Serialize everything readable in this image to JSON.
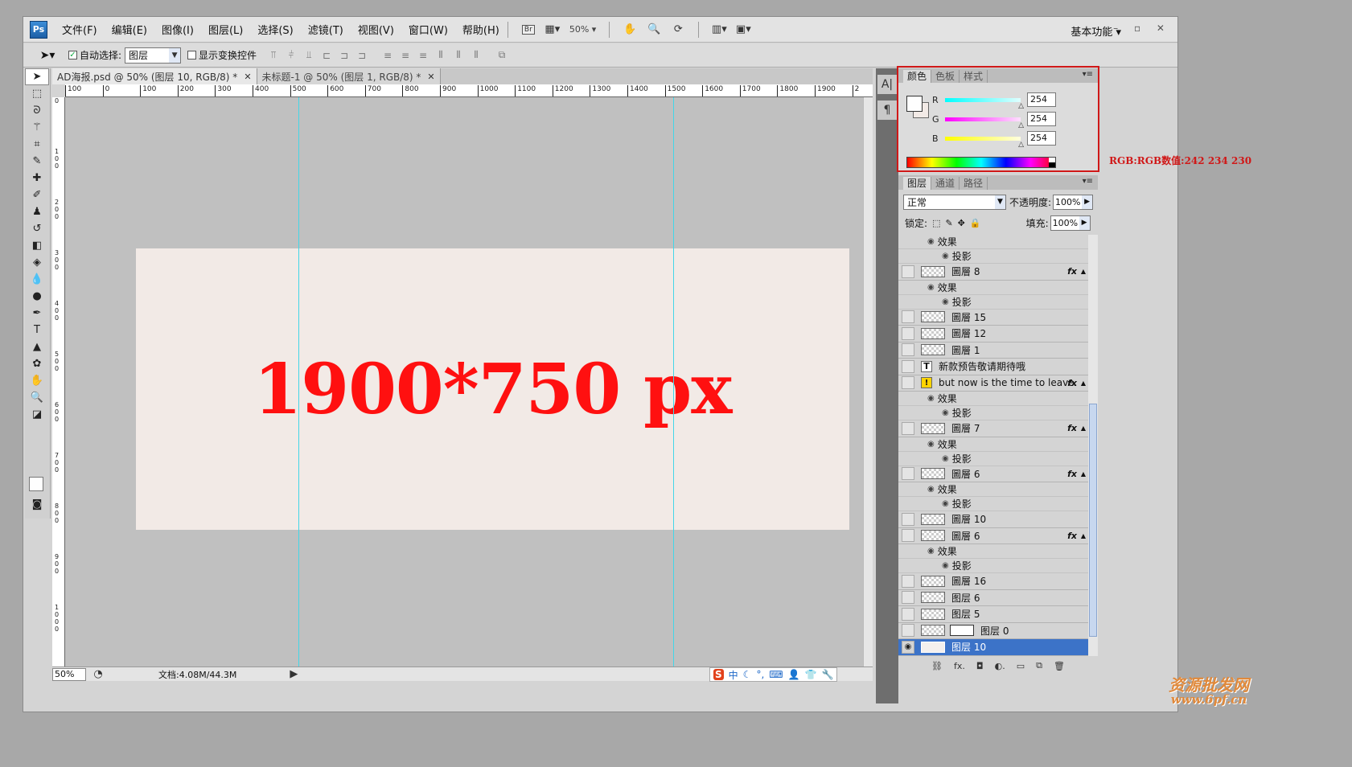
{
  "app": {
    "logo": "Ps",
    "workspace": "基本功能 ▾",
    "window_controls": "– ▫ ✕"
  },
  "menu": [
    "文件(F)",
    "编辑(E)",
    "图像(I)",
    "图层(L)",
    "选择(S)",
    "滤镜(T)",
    "视图(V)",
    "窗口(W)",
    "帮助(H)"
  ],
  "toolbar": {
    "bridge": "Br",
    "zoom": "50%"
  },
  "options": {
    "auto_select_label": "自动选择:",
    "auto_select_checked": true,
    "auto_select_value": "图层",
    "show_transform_label": "显示变换控件",
    "show_transform_checked": false
  },
  "doc_tabs": [
    {
      "label": "AD海报.psd @ 50% (图层 10, RGB/8) *",
      "active": true
    },
    {
      "label": "未标题-1 @ 50% (图层 1, RGB/8) *",
      "active": false
    }
  ],
  "ruler": {
    "h": [
      "100",
      "0",
      "100",
      "200",
      "300",
      "400",
      "500",
      "600",
      "700",
      "800",
      "900",
      "1000",
      "1100",
      "1200",
      "1300",
      "1400",
      "1500",
      "1600",
      "1700",
      "1800",
      "1900",
      "2"
    ],
    "v": [
      "0",
      "1 0 0",
      "2 0 0",
      "3 0 0",
      "4 0 0",
      "5 0 0",
      "6 0 0",
      "7 0 0",
      "8 0 0",
      "9 0 0",
      "1 0 0 0"
    ]
  },
  "canvas": {
    "text": "1900*750 px",
    "bg_color": "#f2eae6",
    "text_color": "#ff1010"
  },
  "status": {
    "zoom": "50%",
    "doc_info": "文档:4.08M/44.3M",
    "ime": "中"
  },
  "color_panel": {
    "tabs": [
      "颜色",
      "色板",
      "样式"
    ],
    "r": "254",
    "g": "254",
    "b": "254"
  },
  "annotation": "RGB:RGB数值:242  234  230",
  "layers_panel": {
    "tabs": [
      "图层",
      "通道",
      "路径"
    ],
    "blend_mode": "正常",
    "opacity_label": "不透明度:",
    "opacity": "100%",
    "lock_label": "锁定:",
    "fill_label": "填充:",
    "fill": "100%",
    "rows": [
      {
        "kind": "effect",
        "label": "效果"
      },
      {
        "kind": "shadow",
        "label": "投影"
      },
      {
        "kind": "layer",
        "label": "圖層 8",
        "fx": true
      },
      {
        "kind": "effect",
        "label": "效果"
      },
      {
        "kind": "shadow",
        "label": "投影"
      },
      {
        "kind": "layer",
        "label": "圖層 15"
      },
      {
        "kind": "layer",
        "label": "圖層 12"
      },
      {
        "kind": "layer",
        "label": "圖層 1"
      },
      {
        "kind": "text",
        "label": "新款预告敬请期待哦"
      },
      {
        "kind": "warn",
        "label": "but now is the time to leave.",
        "fx": true
      },
      {
        "kind": "effect",
        "label": "效果"
      },
      {
        "kind": "shadow",
        "label": "投影"
      },
      {
        "kind": "layer",
        "label": "圖層 7",
        "fx": true
      },
      {
        "kind": "effect",
        "label": "效果"
      },
      {
        "kind": "shadow",
        "label": "投影"
      },
      {
        "kind": "layer",
        "label": "圖層 6",
        "fx": true
      },
      {
        "kind": "effect",
        "label": "效果"
      },
      {
        "kind": "shadow",
        "label": "投影"
      },
      {
        "kind": "layer",
        "label": "圖層 10"
      },
      {
        "kind": "layer",
        "label": "圖層 6",
        "fx": true
      },
      {
        "kind": "effect",
        "label": "效果"
      },
      {
        "kind": "shadow",
        "label": "投影"
      },
      {
        "kind": "layer",
        "label": "圖層 16"
      },
      {
        "kind": "layer",
        "label": "图层 6"
      },
      {
        "kind": "layer",
        "label": "图层 5"
      },
      {
        "kind": "mask",
        "label": "图层 0"
      },
      {
        "kind": "selected",
        "label": "图层 10"
      }
    ]
  },
  "watermark": {
    "line1": "资源批发网",
    "line2": "www.6pf.cn"
  }
}
